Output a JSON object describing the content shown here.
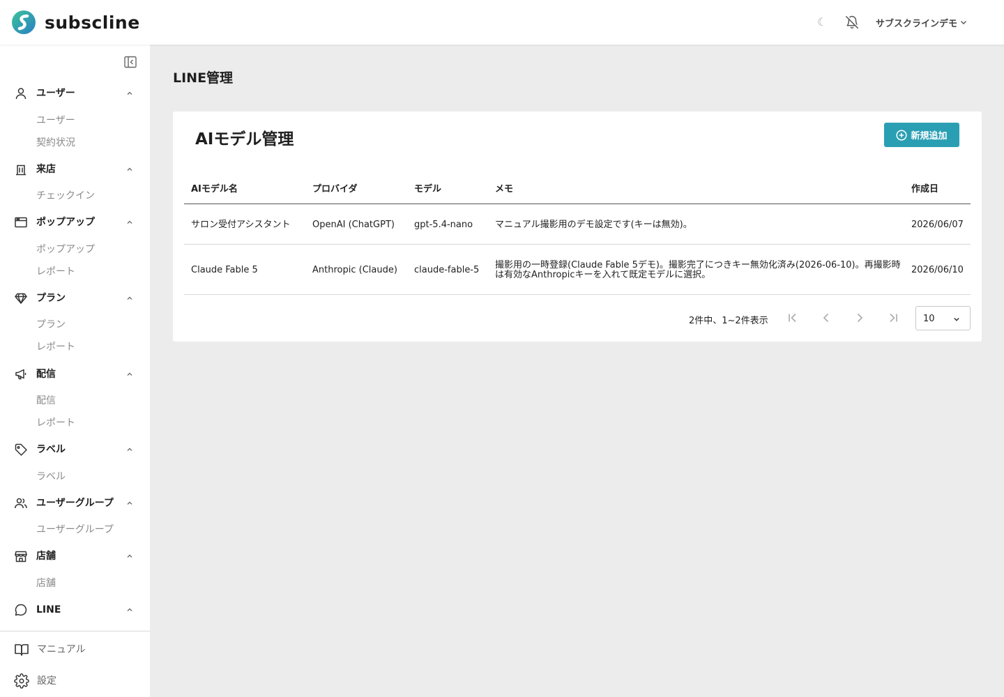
{
  "header": {
    "brand": "subscline",
    "user_name": "サブスクラインデモ",
    "moon_glyph": "☾"
  },
  "sidebar": {
    "sections": [
      {
        "label": "ユーザー",
        "icon": "user-icon",
        "items": [
          "ユーザー",
          "契約状況"
        ]
      },
      {
        "label": "来店",
        "icon": "building-icon",
        "items": [
          "チェックイン"
        ]
      },
      {
        "label": "ポップアップ",
        "icon": "window-icon",
        "items": [
          "ポップアップ",
          "レポート"
        ]
      },
      {
        "label": "プラン",
        "icon": "diamond-icon",
        "items": [
          "プラン",
          "レポート"
        ]
      },
      {
        "label": "配信",
        "icon": "megaphone-icon",
        "items": [
          "配信",
          "レポート"
        ]
      },
      {
        "label": "ラベル",
        "icon": "tag-icon",
        "items": [
          "ラベル"
        ]
      },
      {
        "label": "ユーザーグループ",
        "icon": "users-icon",
        "items": [
          "ユーザーグループ"
        ]
      },
      {
        "label": "店舗",
        "icon": "store-icon",
        "items": [
          "店舗"
        ]
      },
      {
        "label": "LINE",
        "icon": "chat-bubble-icon",
        "items": []
      }
    ],
    "footer": [
      {
        "label": "マニュアル",
        "icon": "book-icon"
      },
      {
        "label": "設定",
        "icon": "gear-icon"
      }
    ]
  },
  "page": {
    "title": "LINE管理"
  },
  "card": {
    "title": "AIモデル管理",
    "add_button": "新規追加",
    "columns": [
      "AIモデル名",
      "プロバイダ",
      "モデル",
      "メモ",
      "作成日"
    ],
    "rows": [
      [
        "サロン受付アシスタント",
        "OpenAI (ChatGPT)",
        "gpt-5.4-nano",
        "マニュアル撮影用のデモ設定です(キーは無効)。",
        "2026/06/07"
      ],
      [
        "Claude Fable 5",
        "Anthropic (Claude)",
        "claude-fable-5",
        "撮影用の一時登録(Claude Fable 5デモ)。撮影完了につきキー無効化済み(2026-06-10)。再撮影時は有効なAnthropicキーを入れて既定モデルに選択。",
        "2026/06/10"
      ]
    ]
  },
  "pagination": {
    "info": "2件中、1~2件表示",
    "page_size": "10"
  },
  "colors": {
    "accent": "#2a9fb3",
    "background": "#ececec",
    "logo_teal": "#3bb8a0",
    "logo_blue": "#2a7fc4"
  }
}
